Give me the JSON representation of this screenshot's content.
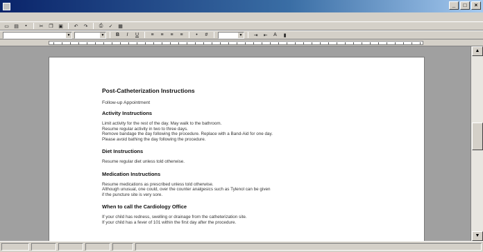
{
  "window": {
    "title": ""
  },
  "menubar": {
    "items": []
  },
  "toolbar": {
    "style_value": "",
    "font_size_value": "",
    "zoom_value": ""
  },
  "document": {
    "title": "Post-Catheterization Instructions",
    "subtitle": "Follow-up Appointment",
    "sections": [
      {
        "heading": "Activity Instructions",
        "lines": [
          "Limit activity for the rest of the day. May walk to the bathroom.",
          "Resume regular activity in two to three days.",
          "Remove bandage the day following the procedure. Replace with a Band-Aid for one day.",
          "Please avoid bathing the day following the procedure."
        ]
      },
      {
        "heading": "Diet Instructions",
        "lines": [
          "Resume regular diet unless told otherwise."
        ]
      },
      {
        "heading": "Medication Instructions",
        "lines": [
          "Resume medications as prescribed unless told otherwise.",
          "Although unusual, one could, over the counter analgesics such as Tylenol can be given",
          "if the puncture site is very sore."
        ]
      },
      {
        "heading": "When to call the Cardiology Office",
        "lines": [
          "If your child has redness, swelling or drainage from the catheterization site.",
          "If your child has a fever of 101 within the first day after the procedure."
        ]
      }
    ]
  },
  "statusbar": {
    "page": "",
    "line": "",
    "col": "",
    "mode": ""
  }
}
